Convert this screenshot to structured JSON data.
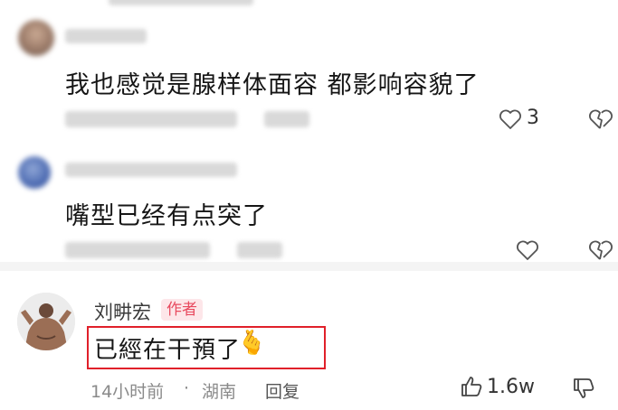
{
  "comments": [
    {
      "text": "我也感觉是腺样体面容  都影响容貌了",
      "like_count": "3"
    },
    {
      "text": "嘴型已经有点突了",
      "like_count": ""
    }
  ],
  "author_reply": {
    "name": "刘畊宏",
    "tag": "作者",
    "text": "已經在干預了",
    "emoji": "🫰",
    "time": "14小时前",
    "separator": "·",
    "location": "湖南",
    "reply_label": "回复",
    "like_count": "1.6w"
  },
  "colors": {
    "highlight_box": "#e0202a",
    "author_tag_text": "#e84a5f",
    "author_tag_bg": "#fde6e9"
  },
  "icons": [
    "heart-icon",
    "broken-heart-icon",
    "thumbs-up-icon",
    "thumbs-down-icon",
    "finger-heart-emoji"
  ]
}
